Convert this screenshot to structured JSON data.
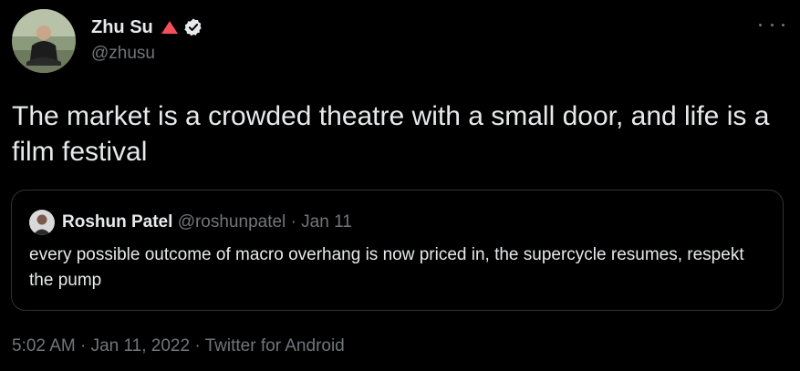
{
  "author": {
    "display_name": "Zhu Su",
    "handle": "@zhusu",
    "emoji_name": "red-triangle-up-icon",
    "verified_icon": "verified-badge-icon",
    "avatar_icon": "avatar-photo"
  },
  "more_menu_icon": "more-dots-icon",
  "tweet": {
    "text": "The market is a crowded theatre with a small door, and life is a film festival"
  },
  "quoted_tweet": {
    "display_name": "Roshun Patel",
    "handle": "@roshunpatel",
    "separator": "·",
    "date": "Jan 11",
    "text": "every possible outcome of macro overhang is now priced in, the supercycle resumes, respekt the pump",
    "avatar_icon": "avatar-photo"
  },
  "meta": {
    "time": "5:02 AM",
    "separator": "·",
    "date": "Jan 11, 2022",
    "source": "Twitter for Android"
  },
  "colors": {
    "background": "#000000",
    "text_primary": "#e7e9ea",
    "text_secondary": "#71767b",
    "border": "#2f3336",
    "triangle_red": "#f4505a"
  }
}
